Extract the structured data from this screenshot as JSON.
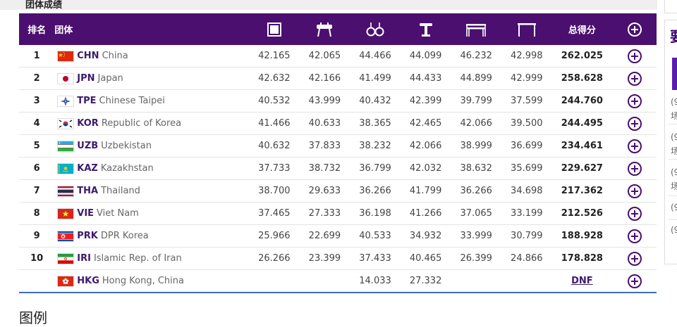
{
  "section_title": "团体成绩",
  "legend_title": "图例",
  "side_panel": {
    "title_char": "要",
    "items": [
      "(9",
      "场",
      "(9",
      "场",
      "(9",
      "场",
      "(9",
      "(9"
    ]
  },
  "headers": {
    "rank": "排名",
    "team": "团体",
    "total": "总得分"
  },
  "apparatus_icons": [
    "floor-exercise-icon",
    "pommel-horse-icon",
    "rings-icon",
    "vault-icon",
    "parallel-bars-icon",
    "horizontal-bar-icon"
  ],
  "colors": {
    "header_bg": "#4a0f6f",
    "accent": "#3d1a6e",
    "bottom_rule": "#3a6fb4"
  },
  "rows": [
    {
      "rank": "1",
      "noc": "CHN",
      "name": "China",
      "flag": "chn",
      "scores": [
        "42.165",
        "42.065",
        "44.466",
        "44.099",
        "46.232",
        "42.998"
      ],
      "total": "262.025"
    },
    {
      "rank": "2",
      "noc": "JPN",
      "name": "Japan",
      "flag": "jpn",
      "scores": [
        "42.632",
        "42.166",
        "41.499",
        "44.433",
        "44.899",
        "42.999"
      ],
      "total": "258.628"
    },
    {
      "rank": "3",
      "noc": "TPE",
      "name": "Chinese Taipei",
      "flag": "tpe",
      "scores": [
        "40.532",
        "43.999",
        "40.432",
        "42.399",
        "39.799",
        "37.599"
      ],
      "total": "244.760"
    },
    {
      "rank": "4",
      "noc": "KOR",
      "name": "Republic of Korea",
      "flag": "kor",
      "scores": [
        "41.466",
        "40.633",
        "38.365",
        "42.465",
        "42.066",
        "39.500"
      ],
      "total": "244.495"
    },
    {
      "rank": "5",
      "noc": "UZB",
      "name": "Uzbekistan",
      "flag": "uzb",
      "scores": [
        "40.632",
        "37.833",
        "38.232",
        "42.066",
        "38.999",
        "36.699"
      ],
      "total": "234.461"
    },
    {
      "rank": "6",
      "noc": "KAZ",
      "name": "Kazakhstan",
      "flag": "kaz",
      "scores": [
        "37.733",
        "38.732",
        "36.799",
        "42.032",
        "38.632",
        "35.699"
      ],
      "total": "229.627"
    },
    {
      "rank": "7",
      "noc": "THA",
      "name": "Thailand",
      "flag": "tha",
      "scores": [
        "38.700",
        "29.633",
        "36.266",
        "41.799",
        "36.266",
        "34.698"
      ],
      "total": "217.362"
    },
    {
      "rank": "8",
      "noc": "VIE",
      "name": "Viet Nam",
      "flag": "vie",
      "scores": [
        "37.465",
        "27.333",
        "36.198",
        "41.266",
        "37.065",
        "33.199"
      ],
      "total": "212.526"
    },
    {
      "rank": "9",
      "noc": "PRK",
      "name": "DPR Korea",
      "flag": "prk",
      "scores": [
        "25.966",
        "22.699",
        "40.533",
        "34.932",
        "33.999",
        "30.799"
      ],
      "total": "188.928"
    },
    {
      "rank": "10",
      "noc": "IRI",
      "name": "Islamic Rep. of Iran",
      "flag": "iri",
      "scores": [
        "26.266",
        "23.399",
        "37.433",
        "40.465",
        "26.399",
        "24.866"
      ],
      "total": "178.828"
    },
    {
      "rank": "",
      "noc": "HKG",
      "name": "Hong Kong, China",
      "flag": "hkg",
      "scores": [
        "",
        "",
        "14.033",
        "27.332",
        "",
        ""
      ],
      "total": "DNF"
    }
  ]
}
